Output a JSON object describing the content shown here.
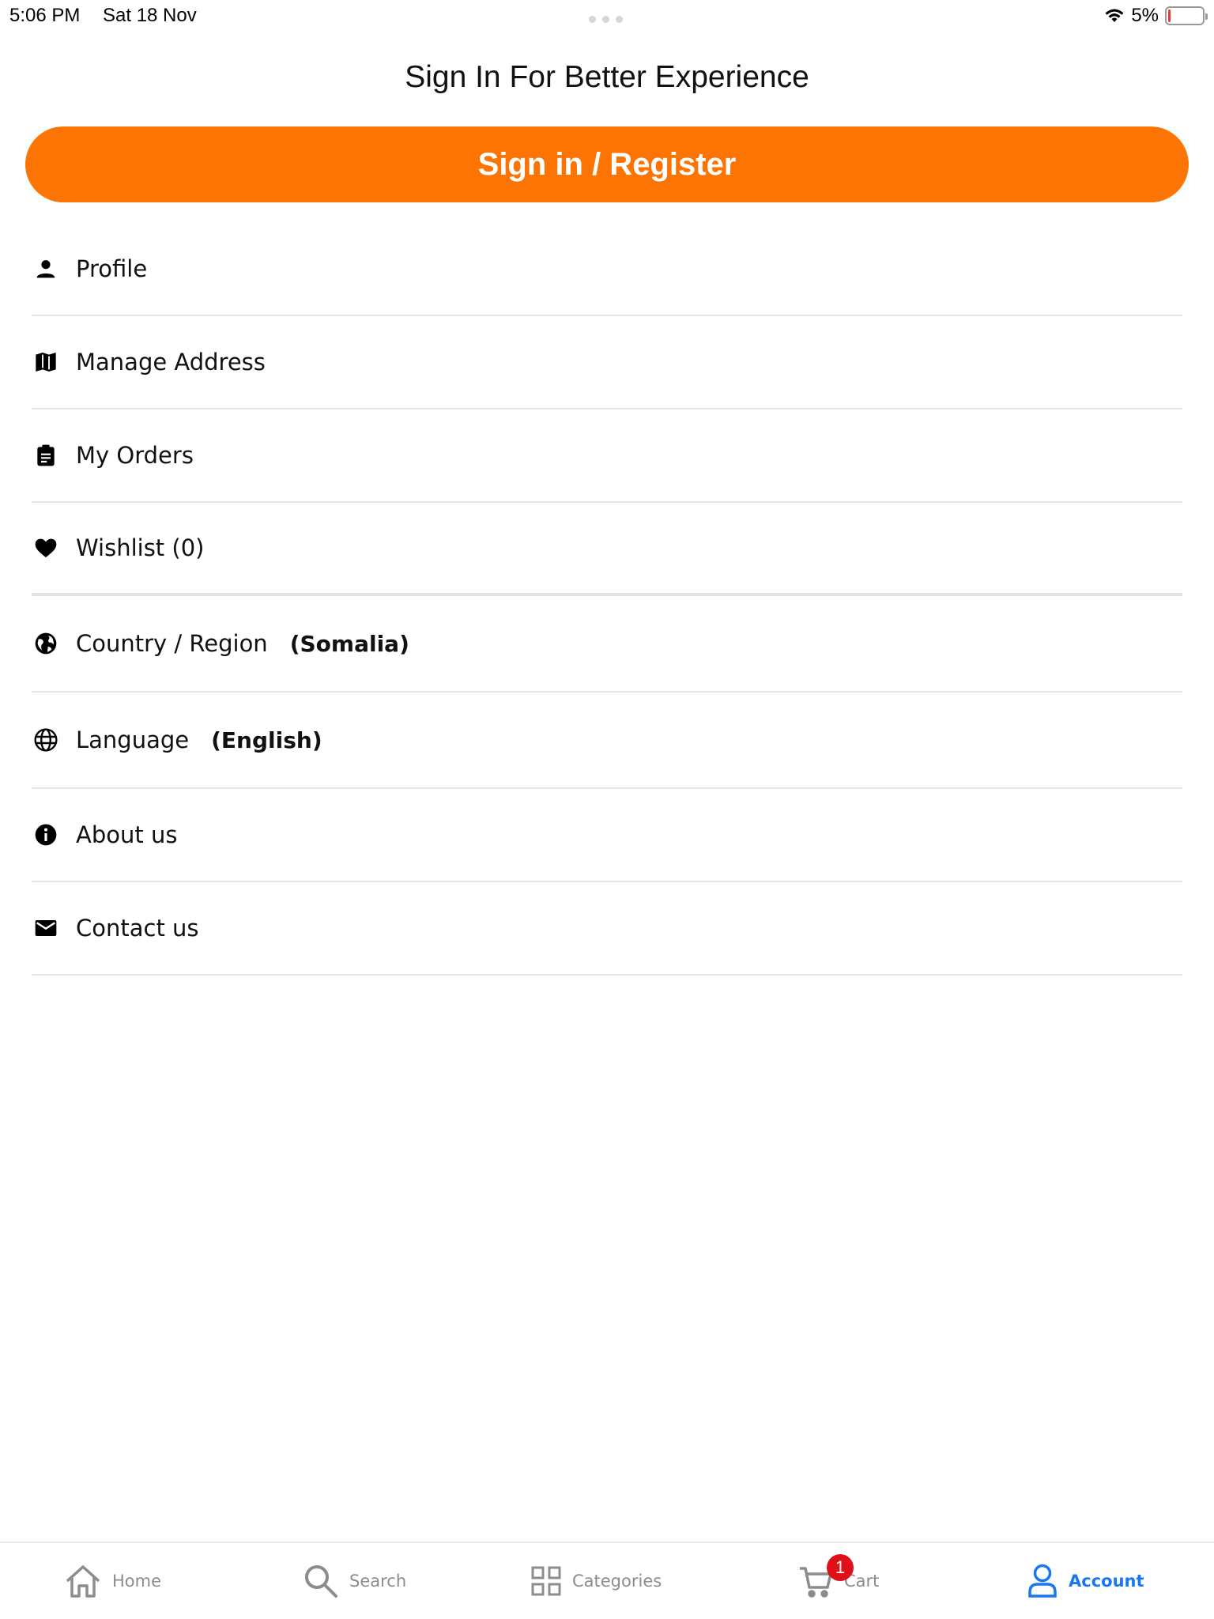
{
  "status_bar": {
    "time": "5:06 PM",
    "date": "Sat 18 Nov",
    "battery": "5%"
  },
  "header": {
    "title": "Sign In For Better Experience",
    "signin_label": "Sign in / Register",
    "accent_color": "#fc7404"
  },
  "menu": {
    "items": [
      {
        "label": "Profile",
        "icon": "person-icon"
      },
      {
        "label": "Manage Address",
        "icon": "map-icon"
      },
      {
        "label": "My Orders",
        "icon": "clipboard-icon"
      },
      {
        "label": "Wishlist (0)",
        "icon": "heart-icon"
      },
      {
        "label": "Country / Region",
        "value": "(Somalia)",
        "icon": "earth-icon"
      },
      {
        "label": "Language",
        "value": "(English)",
        "icon": "globe-icon"
      },
      {
        "label": "About us",
        "icon": "info-icon"
      },
      {
        "label": "Contact us",
        "icon": "envelope-icon"
      }
    ]
  },
  "tab_bar": {
    "active_color": "#1877f2",
    "tabs": [
      {
        "label": "Home",
        "icon": "home-icon"
      },
      {
        "label": "Search",
        "icon": "search-icon"
      },
      {
        "label": "Categories",
        "icon": "grid-icon"
      },
      {
        "label": "Cart",
        "icon": "cart-icon",
        "badge": "1"
      },
      {
        "label": "Account",
        "icon": "user-icon",
        "active": true
      }
    ]
  }
}
